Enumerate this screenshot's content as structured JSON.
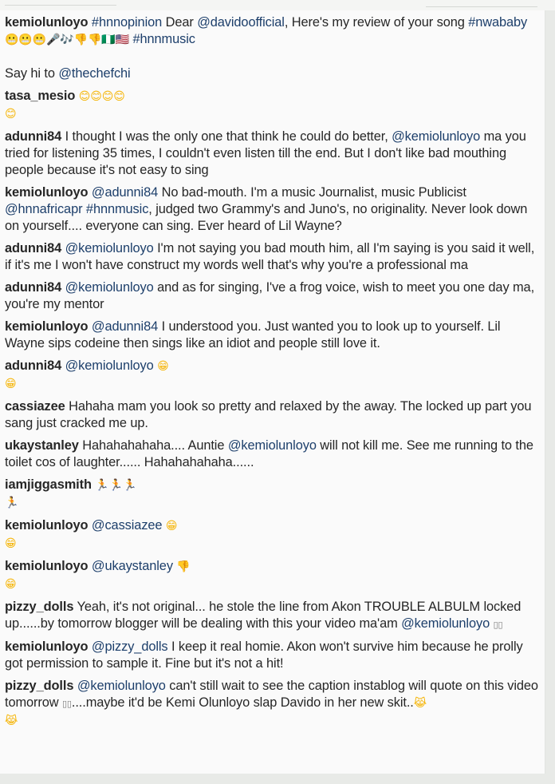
{
  "comments": [
    {
      "user": "kemiolunloyo",
      "parts": [
        {
          "k": "tag",
          "t": "#hnnopinion"
        },
        {
          "k": "text",
          "t": " Dear "
        },
        {
          "k": "mention",
          "t": "@davidoofficial"
        },
        {
          "k": "text",
          "t": ", Here's my review of your song "
        },
        {
          "k": "tag",
          "t": "#nwababy"
        },
        {
          "k": "emoji",
          "t": "😬😬😬🎤🎶👎👎",
          "cls": "face"
        },
        {
          "k": "emoji",
          "t": "🇳🇬🇺🇸",
          "cls": "green"
        },
        {
          "k": "text",
          "t": " "
        },
        {
          "k": "tag",
          "t": "#hnnmusic"
        },
        {
          "k": "br"
        },
        {
          "k": "br"
        },
        {
          "k": "text",
          "t": "Say hi to "
        },
        {
          "k": "mention",
          "t": "@thechefchi"
        }
      ]
    },
    {
      "user": "tasa_mesio",
      "parts": [
        {
          "k": "emoji",
          "t": "😊😊😊😊",
          "cls": "face"
        },
        {
          "k": "br"
        },
        {
          "k": "emoji",
          "t": "😊",
          "cls": "face"
        }
      ]
    },
    {
      "user": "adunni84",
      "parts": [
        {
          "k": "text",
          "t": "I thought I was the only one that think he could do better, "
        },
        {
          "k": "mention",
          "t": "@kemiolunloyo"
        },
        {
          "k": "text",
          "t": " ma you tried for listening 35 times, I couldn't even listen till the end. But I don't like bad mouthing people because it's not easy to sing"
        }
      ]
    },
    {
      "user": "kemiolunloyo",
      "parts": [
        {
          "k": "mention",
          "t": "@adunni84"
        },
        {
          "k": "text",
          "t": " No bad-mouth. I'm a music Journalist, music Publicist "
        },
        {
          "k": "mention",
          "t": "@hnnafricapr"
        },
        {
          "k": "text",
          "t": " "
        },
        {
          "k": "tag",
          "t": "#hnnmusic"
        },
        {
          "k": "text",
          "t": ", judged two Grammy's and Juno's, no originality. Never look down on yourself.... everyone can sing. Ever heard of Lil Wayne?"
        }
      ]
    },
    {
      "user": "adunni84",
      "parts": [
        {
          "k": "mention",
          "t": "@kemiolunloyo"
        },
        {
          "k": "text",
          "t": " I'm not saying you bad mouth him, all I'm saying is you said it well, if it's me I won't have construct my words well that's why you're a professional ma"
        }
      ]
    },
    {
      "user": "adunni84",
      "parts": [
        {
          "k": "mention",
          "t": "@kemiolunloyo"
        },
        {
          "k": "text",
          "t": " and as for singing, I've a frog voice, wish to meet you one day ma, you're my mentor"
        }
      ]
    },
    {
      "user": "kemiolunloyo",
      "parts": [
        {
          "k": "mention",
          "t": "@adunni84"
        },
        {
          "k": "text",
          "t": " I understood you. Just wanted you to look up to yourself. Lil Wayne sips codeine then sings like an idiot and people still love it."
        }
      ]
    },
    {
      "user": "adunni84",
      "parts": [
        {
          "k": "mention",
          "t": "@kemiolunloyo"
        },
        {
          "k": "text",
          "t": " "
        },
        {
          "k": "emoji",
          "t": "😁",
          "cls": "face"
        },
        {
          "k": "br"
        },
        {
          "k": "emoji",
          "t": "😁",
          "cls": "face"
        }
      ]
    },
    {
      "user": "cassiazee",
      "parts": [
        {
          "k": "text",
          "t": "Hahaha mam you look so pretty and relaxed by the away. The locked up part you sang just cracked me up."
        }
      ]
    },
    {
      "user": "ukaystanley",
      "parts": [
        {
          "k": "text",
          "t": "Hahahahahaha.... Auntie "
        },
        {
          "k": "mention",
          "t": "@kemiolunloyo"
        },
        {
          "k": "text",
          "t": " will not kill me. See me running to the toilet cos of laughter...... Hahahahahaha......"
        }
      ]
    },
    {
      "user": "iamjiggasmith",
      "parts": [
        {
          "k": "emoji",
          "t": "🏃🏃🏃",
          "cls": "face"
        },
        {
          "k": "br"
        },
        {
          "k": "emoji",
          "t": "🏃",
          "cls": "face"
        }
      ]
    },
    {
      "user": "kemiolunloyo",
      "parts": [
        {
          "k": "mention",
          "t": "@cassiazee"
        },
        {
          "k": "text",
          "t": " "
        },
        {
          "k": "emoji",
          "t": "😁",
          "cls": "face"
        },
        {
          "k": "br"
        },
        {
          "k": "emoji",
          "t": "😁",
          "cls": "face"
        }
      ]
    },
    {
      "user": "kemiolunloyo",
      "parts": [
        {
          "k": "mention",
          "t": "@ukaystanley"
        },
        {
          "k": "text",
          "t": " "
        },
        {
          "k": "emoji",
          "t": "👎",
          "cls": "face"
        },
        {
          "k": "br"
        },
        {
          "k": "emoji",
          "t": "😁",
          "cls": "face"
        }
      ]
    },
    {
      "user": "pizzy_dolls",
      "parts": [
        {
          "k": "text",
          "t": "Yeah, it's not original... he stole the line from Akon TROUBLE ALBULM locked up......by tomorrow blogger will be dealing with this your video ma'am "
        },
        {
          "k": "mention",
          "t": "@kemiolunloyo"
        },
        {
          "k": "text",
          "t": " "
        },
        {
          "k": "emoji",
          "t": "▯▯",
          "cls": "box"
        }
      ]
    },
    {
      "user": "kemiolunloyo",
      "parts": [
        {
          "k": "mention",
          "t": "@pizzy_dolls"
        },
        {
          "k": "text",
          "t": " I keep it real homie. Akon won't survive him because he prolly got permission to sample it. Fine but it's not a hit!"
        }
      ]
    },
    {
      "user": "pizzy_dolls",
      "parts": [
        {
          "k": "mention",
          "t": "@kemiolunloyo"
        },
        {
          "k": "text",
          "t": " can't still wait to see the caption instablog will quote on this video tomorrow "
        },
        {
          "k": "emoji",
          "t": "▯▯",
          "cls": "box"
        },
        {
          "k": "text",
          "t": "....maybe it'd be Kemi Olunloyo slap Davido in her new skit.."
        },
        {
          "k": "emoji",
          "t": "😹",
          "cls": "face"
        },
        {
          "k": "br"
        },
        {
          "k": "emoji",
          "t": "😹",
          "cls": "face"
        }
      ]
    }
  ]
}
